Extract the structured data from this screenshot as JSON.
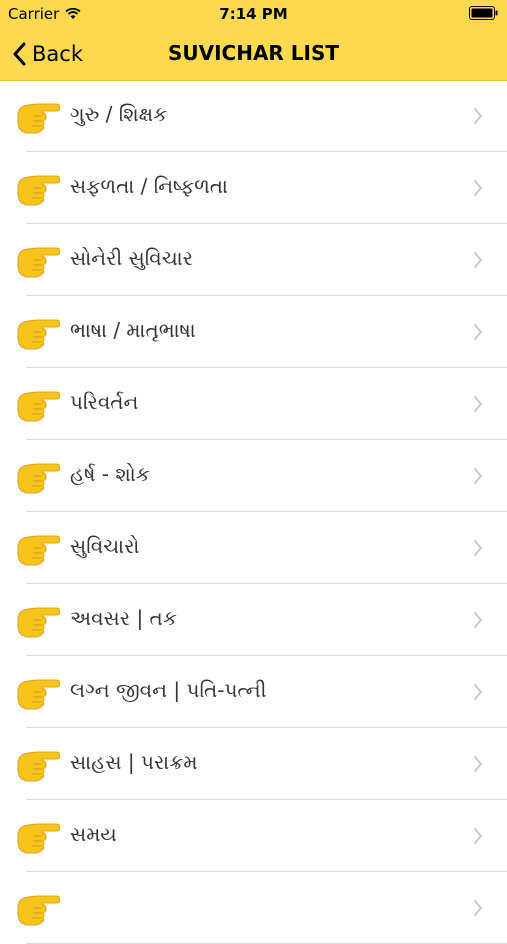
{
  "status_bar": {
    "carrier": "Carrier",
    "time": "7:14 PM"
  },
  "nav": {
    "back_label": "Back",
    "title": "SUVICHAR LIST"
  },
  "list": {
    "items": [
      {
        "label": "ગુરુ / શિક્ષક"
      },
      {
        "label": "સફળતા / નિષ્ફળતા"
      },
      {
        "label": "સોનેરી સુવિચાર"
      },
      {
        "label": "ભાષા / માતૃભાષા"
      },
      {
        "label": "પરિવર્તન"
      },
      {
        "label": "હર્ષ - શોક"
      },
      {
        "label": "સુવિચારો"
      },
      {
        "label": "અવસર | તક"
      },
      {
        "label": "લગ્ન જીવન | પતિ-પત્ની"
      },
      {
        "label": "સાહસ | પરાક્રમ"
      },
      {
        "label": "સમય"
      },
      {
        "label": ""
      }
    ],
    "item_icon": "pointing-hand-icon",
    "accent_color": "#fdd94f",
    "icon_color": "#f7c31d"
  }
}
